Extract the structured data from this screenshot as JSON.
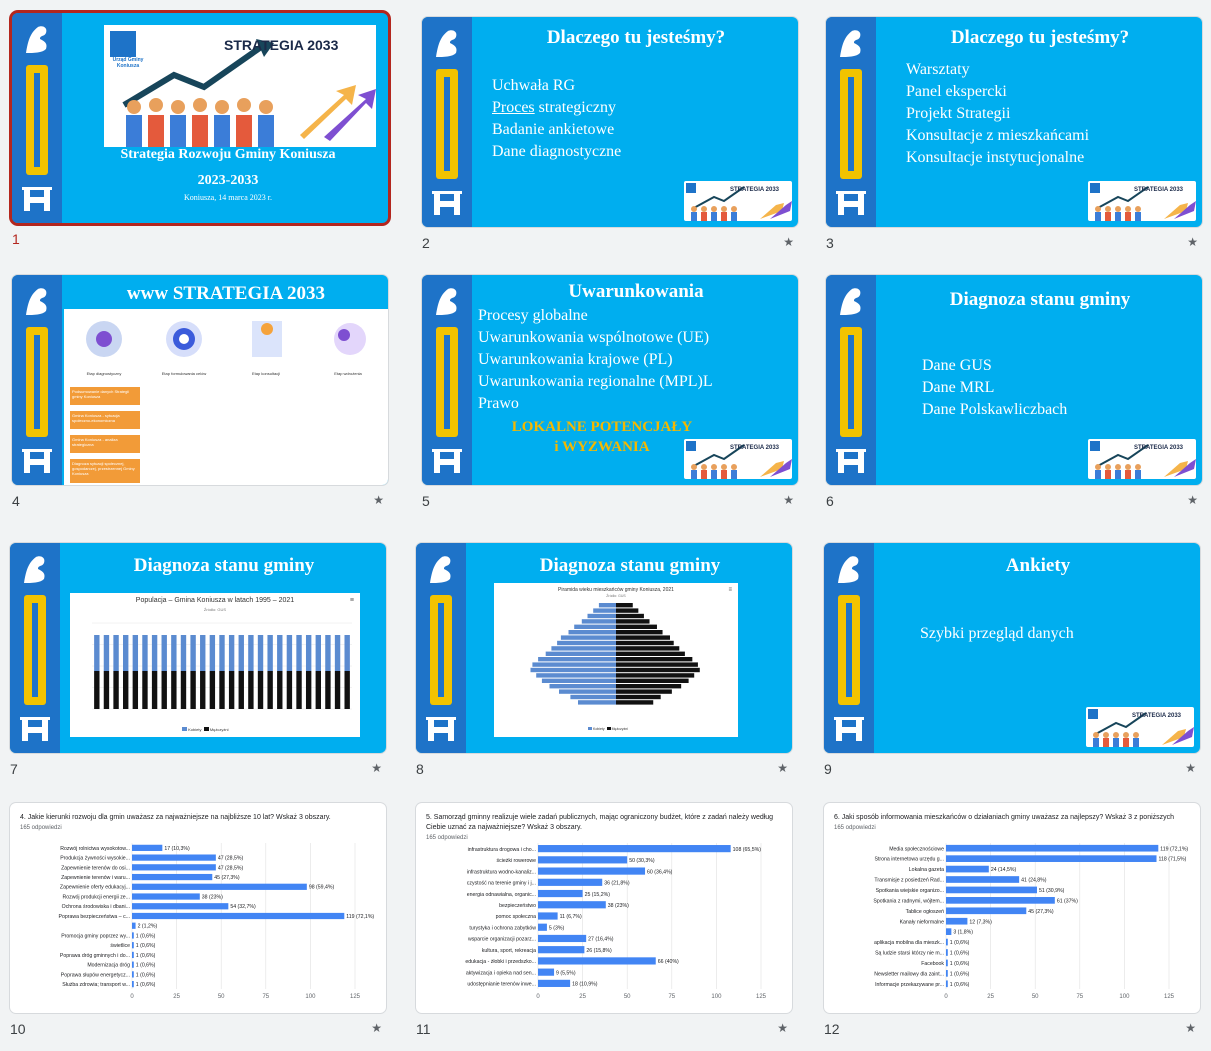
{
  "slides": [
    {
      "num": "1",
      "title": "Strategia Rozwoju Gminy Koniusza",
      "years": "2023-2033",
      "date": "Koniusza, 14 marca 2023 r.",
      "banner": "STRATEGIA 2033",
      "crest_text": "Urząd Gminy Koniusza"
    },
    {
      "num": "2",
      "title": "Dlaczego tu jesteśmy?",
      "lines": [
        "Uchwała RG",
        "Proces",
        " strategiczny",
        "Badanie ankietowe",
        "Dane diagnostyczne"
      ]
    },
    {
      "num": "3",
      "title": "Dlaczego tu jesteśmy?",
      "lines": [
        "Warsztaty",
        "Panel ekspercki",
        "Projekt Strategii",
        "Konsultacje z mieszkańcami",
        "Konsultacje instytucjonalne"
      ]
    },
    {
      "num": "4",
      "title": "www STRATEGIA 2033",
      "steps": [
        "Etap diagnostyczny",
        "Etap formułowania celów",
        "Etap konsultacji",
        "Etap wdrożenia"
      ],
      "buttons": [
        "Podsumowanie danych Strategii gminy Koniusza",
        "Gmina Koniusza - sytuacja społeczno-ekonomiczna",
        "Gmina Koniusza - analiza strategiczna",
        "Diagnoza sytuacji społecznej, gospodarczej, przestrzennej Gminy Koniusza"
      ]
    },
    {
      "num": "5",
      "title": "Uwarunkowania",
      "lines": [
        "Procesy globalne",
        "Uwarunkowania wspólnotowe (UE)",
        "Uwarunkowania krajowe (PL)",
        "Uwarunkowania regionalne (MPL)L",
        "Prawo"
      ],
      "highlight": [
        "LOKALNE POTENCJAŁY",
        "i WYZWANIA"
      ]
    },
    {
      "num": "6",
      "title": "Diagnoza stanu gminy",
      "lines": [
        "Dane GUS",
        "Dane MRL",
        "Dane Polskawliczbach"
      ]
    },
    {
      "num": "7",
      "title": "Diagnoza stanu gminy",
      "chart_title": "Populacja – Gmina Koniusza w latach 1995 – 2021",
      "chart_sub": "Źródło: GUS",
      "legend": [
        "Kobiety",
        "Mężczyźni"
      ]
    },
    {
      "num": "8",
      "title": "Diagnoza stanu gminy",
      "chart_title": "Piramida wieku mieszkańców gminy Koniusza, 2021",
      "chart_sub": "Źródło: GUS",
      "legend": [
        "Kobiety",
        "Mężczyźni"
      ]
    },
    {
      "num": "9",
      "title": "Ankiety",
      "lines": [
        "Szybki przegląd danych"
      ]
    },
    {
      "num": "10",
      "question": "4. Jakie kierunki rozwoju dla gmin uważasz za najważniejsze na najbliższe 10 lat? Wskaż 3 obszary.",
      "count": "165 odpowiedzi"
    },
    {
      "num": "11",
      "question": "5. Samorząd gminny realizuje wiele zadań publicznych, mając ograniczony budżet, które z zadań należy według Ciebie uznać za najważniejsze? Wskaż 3 obszary.",
      "count": "165 odpowiedzi"
    },
    {
      "num": "12",
      "question": "6. Jaki sposób informowania mieszkańców o działaniach gminy uważasz za najlepszy? Wskaż 3 z poniższych",
      "count": "165 odpowiedzi"
    }
  ],
  "chart_data": [
    {
      "type": "bar",
      "orientation": "horizontal",
      "categories": [
        "Rozwój rolnictwa wysokotow...",
        "Produkcja żywności wysokie...",
        "Zapewnienie terenów do osi...",
        "Zapewnienie terenów i waru...",
        "Zapewnienie oferty edukacyj...",
        "Rozwój produkcji energii ze...",
        "Ochrona środowiska i dbani...",
        "Poprawa bezpieczeństwa – c...",
        "",
        "Promocja gminy poprzez wy...",
        "świetlice",
        "Poprawa dróg gminnych i do...",
        "Modernizacja dróg",
        "Poprawa słupów energetycz...",
        "Służba zdrowia; transport w..."
      ],
      "values": [
        17,
        47,
        47,
        45,
        98,
        38,
        54,
        119,
        2,
        1,
        1,
        1,
        1,
        1,
        1
      ],
      "labels": [
        "17 (10,3%)",
        "47 (28,5%)",
        "47 (28,5%)",
        "45 (27,3%)",
        "98 (59,4%)",
        "38 (23%)",
        "54 (32,7%)",
        "119 (72,1%)",
        "2 (1,2%)",
        "1 (0,6%)",
        "1 (0,6%)",
        "1 (0,6%)",
        "1 (0,6%)",
        "1 (0,6%)",
        "1 (0,6%)"
      ],
      "xticks": [
        "0",
        "25",
        "50",
        "75",
        "100",
        "125"
      ],
      "xlim": [
        0,
        125
      ]
    },
    {
      "type": "bar",
      "orientation": "horizontal",
      "categories": [
        "infrastruktura drogowa i cho...",
        "ścieżki rowerowe",
        "infrastruktura wodno-kanaliz...",
        "czystość na terenie gminy i j...",
        "energia odnawialna, organic...",
        "bezpieczeństwo",
        "pomoc społeczna",
        "turystyka i ochrona zabytków",
        "wsparcie organizacji pozarz...",
        "kultura, sport, rekreacja",
        "edukacja - żłobki i przedszko...",
        "aktywizacja i opieka nad sen...",
        "udostępnianie terenów inwe..."
      ],
      "values": [
        108,
        50,
        60,
        36,
        25,
        38,
        11,
        5,
        27,
        26,
        66,
        9,
        18
      ],
      "labels": [
        "108 (65,5%)",
        "50 (30,3%)",
        "60 (36,4%)",
        "36 (21,8%)",
        "25 (15,2%)",
        "38 (23%)",
        "11 (6,7%)",
        "5 (3%)",
        "27 (16,4%)",
        "26 (15,8%)",
        "66 (40%)",
        "9 (5,5%)",
        "18 (10,9%)"
      ],
      "xticks": [
        "0",
        "25",
        "50",
        "75",
        "100",
        "125"
      ],
      "xlim": [
        0,
        125
      ]
    },
    {
      "type": "bar",
      "orientation": "horizontal",
      "categories": [
        "Media społecznościowe",
        "Strona internetowa urzędu g...",
        "Lokalna gazeta",
        "Transmisje z posiedzeń Rad...",
        "Spotkania wiejskie organizo...",
        "Spotkania z radnymi, wójtem...",
        "Tablice ogłoszeń",
        "Kanały nieformalne",
        "",
        "aplikacja mobilna dla mieszk...",
        "Są ludzie starsi którzy nie m...",
        "Facebook",
        "Newsletter mailowy dla zaint...",
        "Informacje przekazywane pr..."
      ],
      "values": [
        119,
        118,
        24,
        41,
        51,
        61,
        45,
        12,
        3,
        1,
        1,
        1,
        1,
        1
      ],
      "labels": [
        "119 (72,1%)",
        "118 (71,5%)",
        "24 (14,5%)",
        "41 (24,8%)",
        "51 (30,9%)",
        "61 (37%)",
        "45 (27,3%)",
        "12 (7,3%)",
        "3 (1,8%)",
        "1 (0,6%)",
        "1 (0,6%)",
        "1 (0,6%)",
        "1 (0,6%)",
        "1 (0,6%)"
      ],
      "xticks": [
        "0",
        "25",
        "50",
        "75",
        "100",
        "125"
      ],
      "xlim": [
        0,
        125
      ]
    }
  ],
  "colors": {
    "slide_bg": "#00aeef",
    "band": "#1e73c8",
    "gold": "#f2c300",
    "bar": "#4285f4",
    "selected": "#b3261e"
  }
}
